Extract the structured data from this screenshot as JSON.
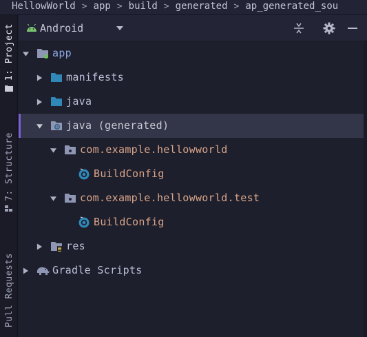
{
  "breadcrumb": [
    "HellowWorld",
    "app",
    "build",
    "generated",
    "ap_generated_sou"
  ],
  "sidebar": {
    "project_tab": "1: Project",
    "structure_tab": "7: Structure",
    "pull_requests_tab": "Pull Requests"
  },
  "header": {
    "view_mode": "Android",
    "icons": [
      "android-icon",
      "chevron-down-icon",
      "collapse-all-icon",
      "gear-icon",
      "hide-icon"
    ]
  },
  "tree": [
    {
      "label": "app",
      "depth": 0,
      "expanded": true,
      "kind": "module"
    },
    {
      "label": "manifests",
      "depth": 1,
      "expanded": false,
      "kind": "folder"
    },
    {
      "label": "java",
      "depth": 1,
      "expanded": false,
      "kind": "folder"
    },
    {
      "label": "java (generated)",
      "depth": 1,
      "expanded": true,
      "kind": "generated-folder",
      "selected": true
    },
    {
      "label": "com.example.hellowworld",
      "depth": 2,
      "expanded": true,
      "kind": "package"
    },
    {
      "label": "BuildConfig",
      "depth": 3,
      "kind": "class"
    },
    {
      "label": "com.example.hellowworld.test",
      "depth": 2,
      "expanded": true,
      "kind": "package"
    },
    {
      "label": "BuildConfig",
      "depth": 3,
      "kind": "class"
    },
    {
      "label": "res",
      "depth": 1,
      "expanded": false,
      "kind": "res-folder"
    },
    {
      "label": "Gradle Scripts",
      "depth": 0,
      "expanded": false,
      "kind": "gradle"
    }
  ],
  "colors": {
    "background": "#1e1f2c",
    "selection": "#333548",
    "selection_accent": "#7b5fd6",
    "android_green": "#7ac46e",
    "folder_blue": "#2f88b8",
    "package_orange": "#d9a58a"
  }
}
